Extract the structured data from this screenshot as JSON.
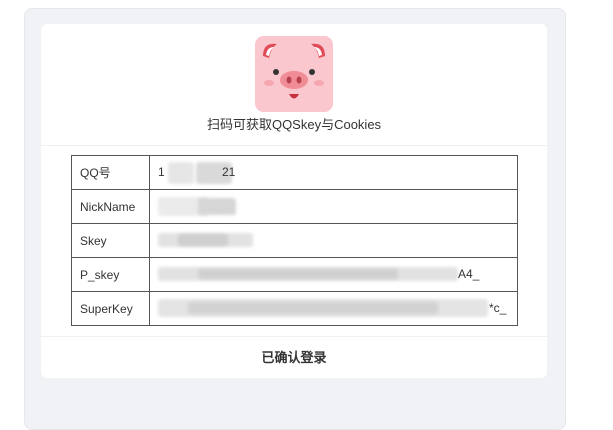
{
  "header": {
    "subtitle": "扫码可获取QQSkey与Cookies",
    "avatar_icon": "pig-face-icon"
  },
  "rows": [
    {
      "label": "QQ号",
      "value_start": "1",
      "value_end": "21"
    },
    {
      "label": "NickName",
      "value_start": "",
      "value_end": ""
    },
    {
      "label": "Skey",
      "value_start": "",
      "value_end": ""
    },
    {
      "label": "P_skey",
      "value_start": "",
      "value_end": "A4_"
    },
    {
      "label": "SuperKey",
      "value_start": "",
      "value_end": "*c_"
    }
  ],
  "footer": {
    "status": "已确认登录"
  },
  "colors": {
    "panel_bg": "#f0f2f5",
    "card_bg": "#ffffff",
    "avatar_bg": "#f9c7cd",
    "table_border": "#555555",
    "text": "#333333"
  }
}
